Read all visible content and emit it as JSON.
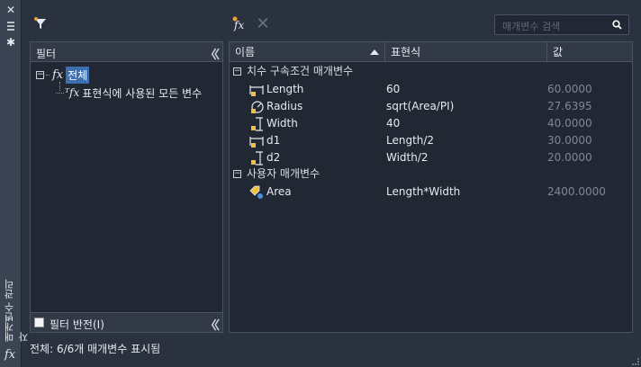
{
  "palette": {
    "title": "매개변수 관리자",
    "fx_symbol": "fx"
  },
  "toolbar": {
    "filter_icon": "funnel-filter-icon",
    "new_expression_icon": "new-user-parameter-icon",
    "delete_icon": "delete-x-icon",
    "search_placeholder": "매개변수 검색",
    "search_icon": "magnifier-icon"
  },
  "filter_panel": {
    "header": "필터",
    "collapse_icon": "double-chevron-left-icon",
    "tree": [
      {
        "label": "전체",
        "selected": true
      },
      {
        "label": "표현식에 사용된 모든 변수",
        "selected": false
      }
    ],
    "invert_filter_label": "필터 반전(I)",
    "invert_checked": false
  },
  "grid": {
    "columns": [
      "이름",
      "표현식",
      "값"
    ],
    "sort_icon": "sort-ascending-icon",
    "groups": [
      {
        "title": "치수 구속조건 매개변수",
        "rows": [
          {
            "icon": "linear-constraint-icon",
            "name": "Length",
            "expression": "60",
            "value": "60.0000"
          },
          {
            "icon": "radial-constraint-icon",
            "name": "Radius",
            "expression": "sqrt(Area/PI)",
            "value": "27.6395"
          },
          {
            "icon": "vertical-constraint-icon",
            "name": "Width",
            "expression": "40",
            "value": "40.0000"
          },
          {
            "icon": "linear-constraint-icon",
            "name": "d1",
            "expression": "Length/2",
            "value": "30.0000"
          },
          {
            "icon": "vertical-constraint-icon",
            "name": "d2",
            "expression": "Width/2",
            "value": "20.0000"
          }
        ]
      },
      {
        "title": "사용자 매개변수",
        "rows": [
          {
            "icon": "user-parameter-icon",
            "name": "Area",
            "expression": "Length*Width",
            "value": "2400.0000"
          }
        ]
      }
    ]
  },
  "status": "전체: 6/6개 매개변수 표시됨"
}
